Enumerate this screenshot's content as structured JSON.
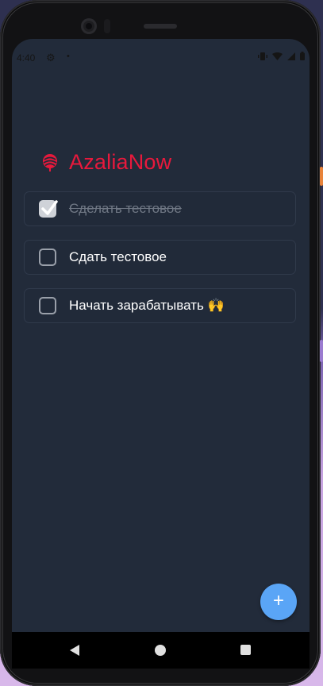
{
  "status_bar": {
    "time": "4:40",
    "icons": [
      "settings-gear-icon",
      "notification-dot-icon",
      "vibrate-icon",
      "wifi-icon",
      "cellular-signal-icon",
      "battery-icon"
    ]
  },
  "app": {
    "title": "AzaliaNow",
    "logo_icon": "rose-icon",
    "accent_color": "#e8193c",
    "background_color": "#222b3a"
  },
  "todos": [
    {
      "text": "Сделать тестовое",
      "done": true
    },
    {
      "text": "Сдать тестовое",
      "done": false
    },
    {
      "text": "Начать зарабатывать 🙌",
      "done": false
    }
  ],
  "fab": {
    "label": "+",
    "color": "#5aa5f6"
  },
  "nav_bar": {
    "icons": [
      "back-icon",
      "home-icon",
      "recents-icon"
    ]
  }
}
